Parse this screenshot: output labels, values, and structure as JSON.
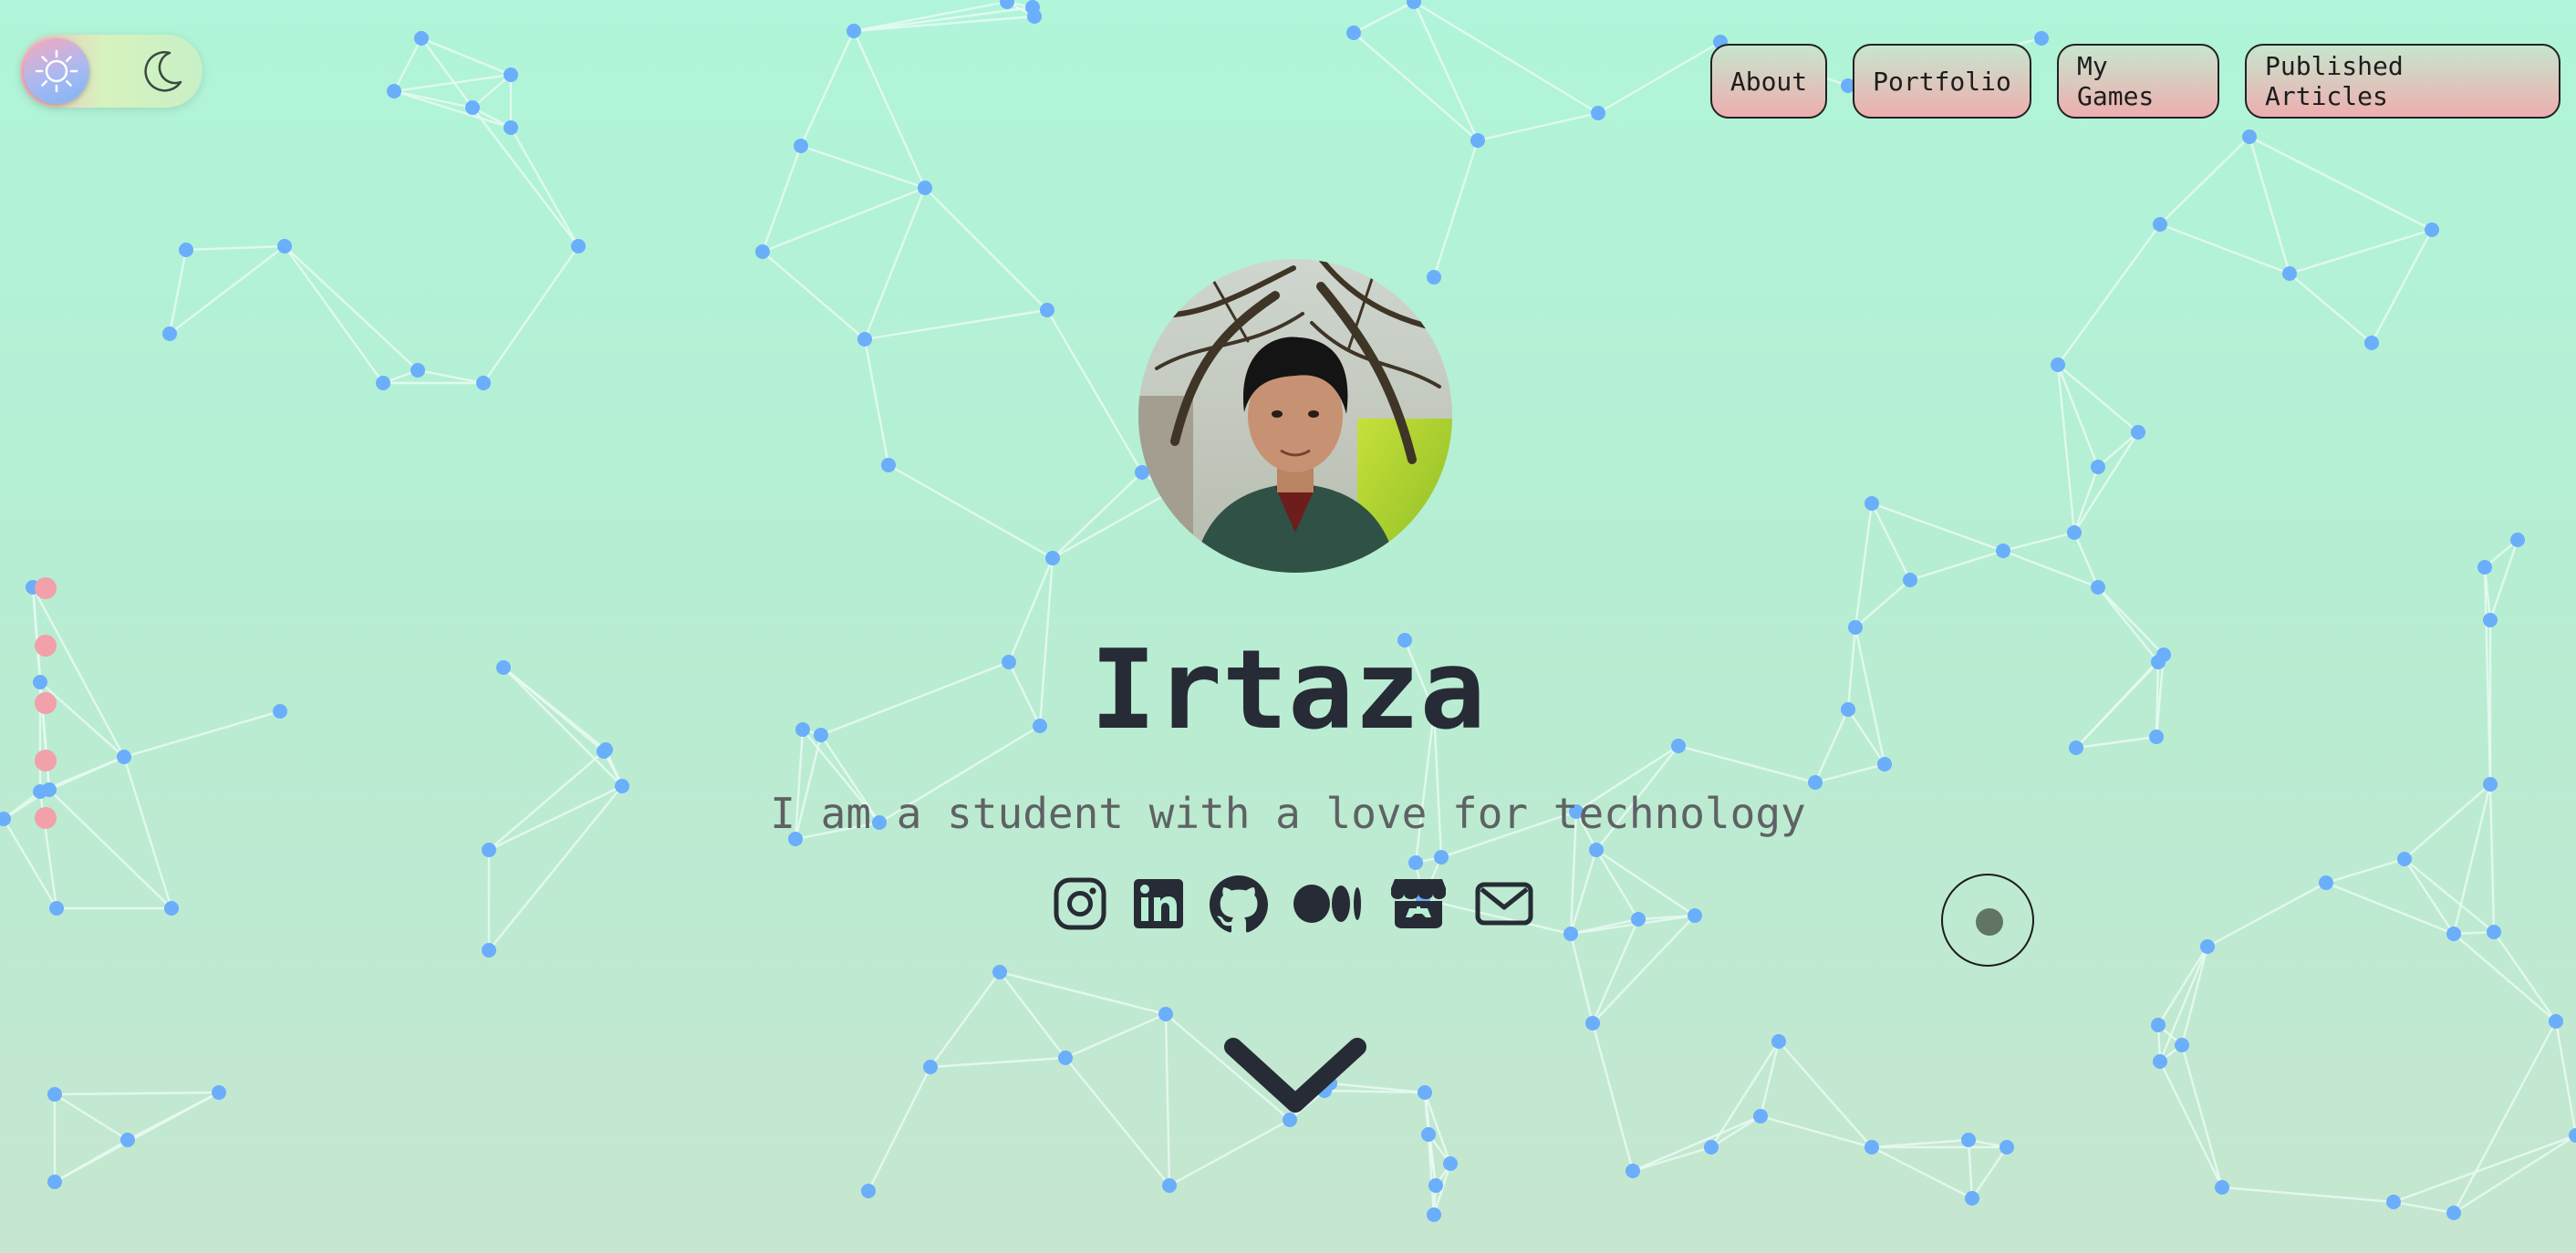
{
  "theme_toggle": {
    "mode": "light",
    "sun_icon": "sun-icon",
    "moon_icon": "moon-icon"
  },
  "nav": {
    "items": [
      {
        "label": "About"
      },
      {
        "label": "Portfolio"
      },
      {
        "label": "My Games"
      },
      {
        "label": "Published Articles"
      }
    ]
  },
  "hero": {
    "avatar": "profile-photo",
    "name": "Irtaza",
    "tagline": "I am a student with a love for technology"
  },
  "social_links": [
    {
      "icon": "instagram-icon"
    },
    {
      "icon": "linkedin-icon"
    },
    {
      "icon": "github-icon"
    },
    {
      "icon": "medium-icon"
    },
    {
      "icon": "itchio-icon"
    },
    {
      "icon": "email-icon"
    }
  ],
  "scroll_icon": "chevron-down-icon",
  "section_indicator": {
    "count": 5,
    "active": 0
  },
  "colors": {
    "background_top": "#b0f5d9",
    "background_bottom": "#c6e6d0",
    "network_node": "#6aaefc",
    "nav_button_top": "#c6e6ce",
    "nav_button_bottom": "#edaeaf",
    "section_dot": "#f2a0aa",
    "text_dark": "#262b35",
    "text_muted": "#5f6264"
  }
}
